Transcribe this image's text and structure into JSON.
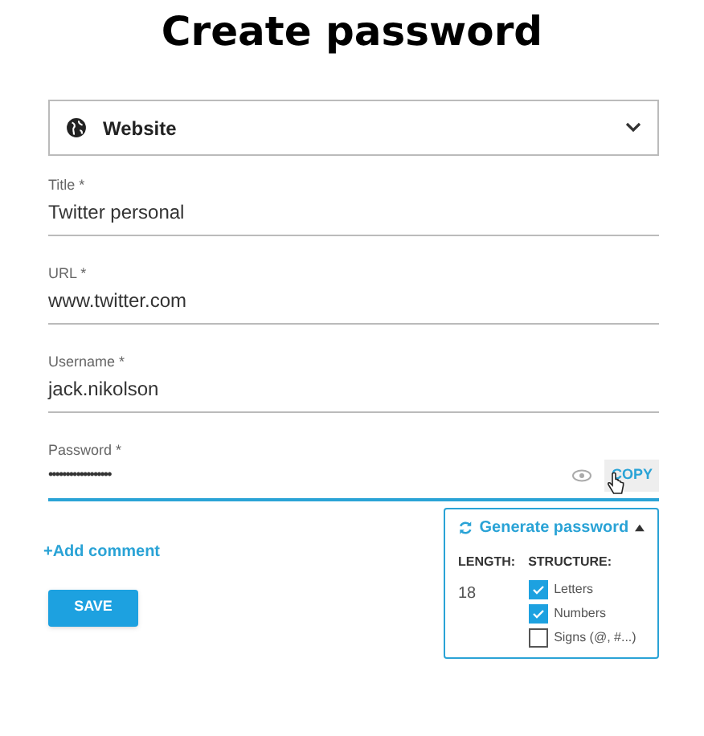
{
  "heading": "Create password",
  "type_select": {
    "value": "Website"
  },
  "fields": [
    {
      "label": "Title *",
      "value": "Twitter personal",
      "focused": false
    },
    {
      "label": "URL *",
      "value": "www.twitter.com",
      "focused": false
    },
    {
      "label": "Username *",
      "value": "jack.nikolson",
      "focused": false
    }
  ],
  "password": {
    "label": "Password *",
    "value": "••••••••••••••••••",
    "focused": true,
    "copy": "COPY"
  },
  "generator": {
    "title": "Generate password",
    "expanded": true,
    "length_label": "LENGTH:",
    "length": "18",
    "structure_label": "STRUCTURE:",
    "options": [
      {
        "label": "Letters",
        "checked": true
      },
      {
        "label": "Numbers",
        "checked": true
      },
      {
        "label": "Signs (@, #...)",
        "checked": false
      }
    ]
  },
  "add_comment": "+Add comment",
  "save": "SAVE"
}
